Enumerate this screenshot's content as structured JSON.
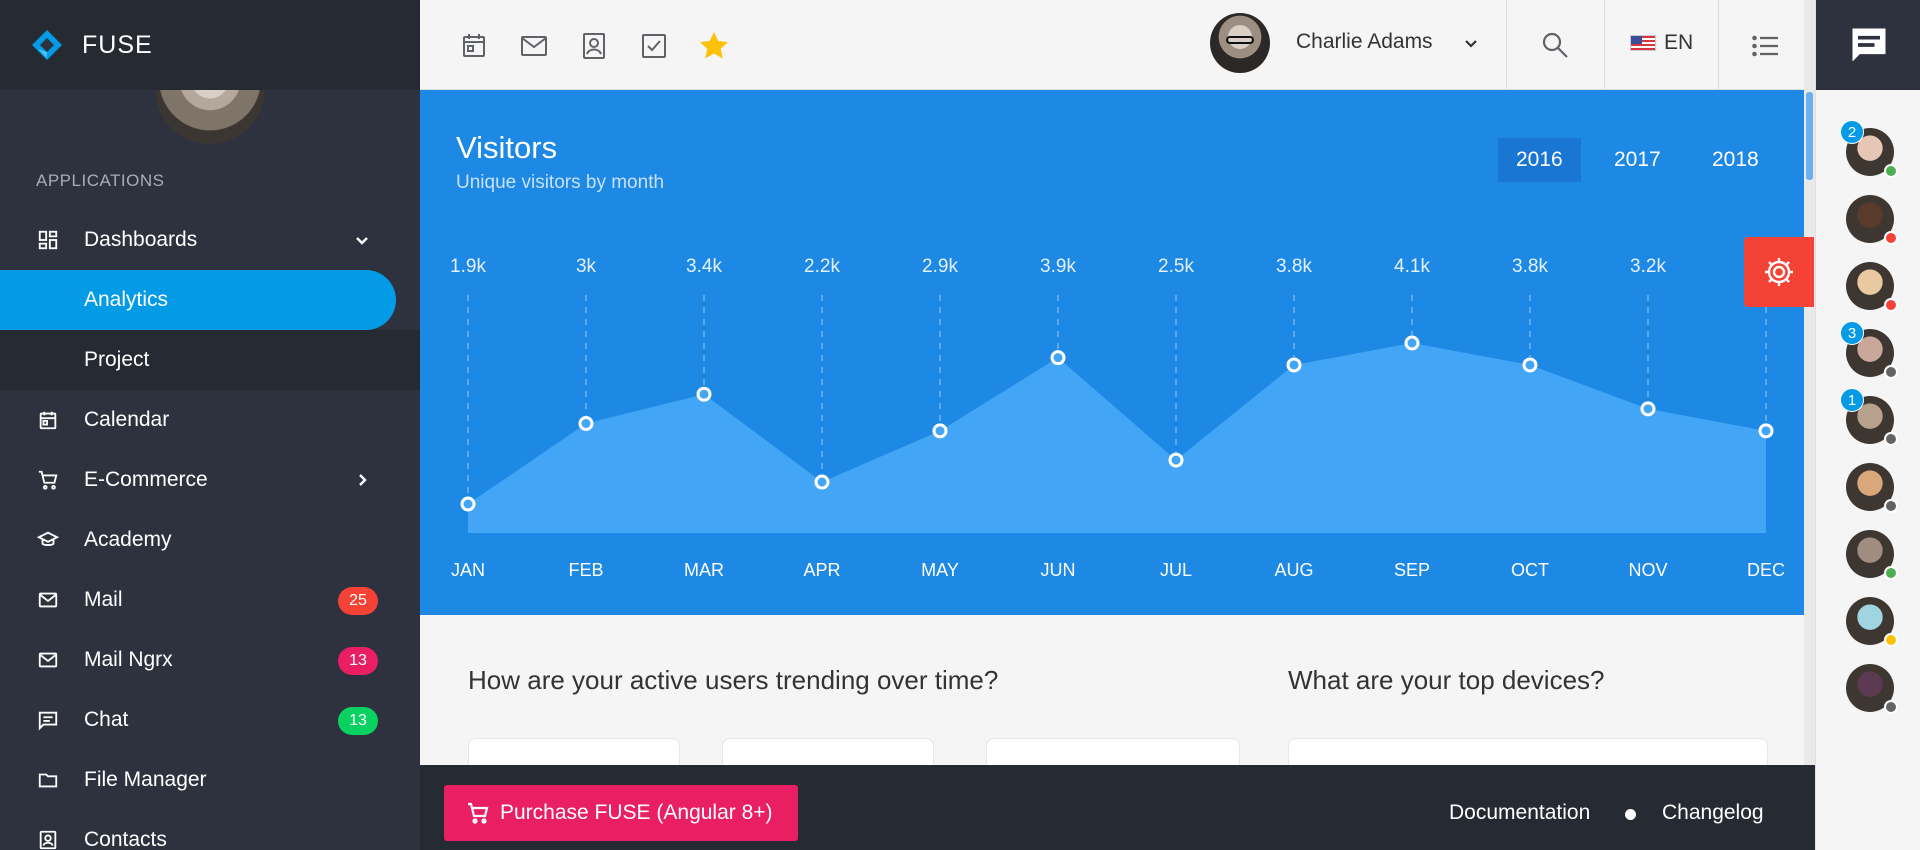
{
  "brand": {
    "name": "FUSE"
  },
  "sidebar": {
    "section_title": "APPLICATIONS",
    "items": [
      {
        "label": "Dashboards",
        "icon": "dashboard-icon",
        "caret": "chevron-down"
      },
      {
        "label": "Analytics",
        "sub": true,
        "active": true
      },
      {
        "label": "Project",
        "sub": true
      },
      {
        "label": "Calendar",
        "icon": "calendar-icon"
      },
      {
        "label": "E-Commerce",
        "icon": "cart-icon",
        "caret": "chevron-right"
      },
      {
        "label": "Academy",
        "icon": "school-icon"
      },
      {
        "label": "Mail",
        "icon": "mail-icon",
        "badge": "25",
        "badge_color": "#f44336"
      },
      {
        "label": "Mail Ngrx",
        "icon": "mail-icon",
        "badge": "13",
        "badge_color": "#e91e63"
      },
      {
        "label": "Chat",
        "icon": "chat-icon",
        "badge": "13",
        "badge_color": "#09d261"
      },
      {
        "label": "File Manager",
        "icon": "folder-icon"
      },
      {
        "label": "Contacts",
        "icon": "contacts-icon"
      }
    ]
  },
  "toolbar": {
    "shortcuts": [
      "calendar-icon",
      "mail-icon",
      "contacts-icon",
      "todo-icon",
      "star-icon"
    ],
    "star_color": "#ffc107",
    "user_name": "Charlie Adams",
    "language": "EN"
  },
  "visitors": {
    "title": "Visitors",
    "subtitle": "Unique visitors by month",
    "years": [
      "2016",
      "2017",
      "2018"
    ],
    "selected_year": "2016"
  },
  "chart_data": {
    "type": "area",
    "title": "Visitors",
    "subtitle": "Unique visitors by month",
    "categories": [
      "JAN",
      "FEB",
      "MAR",
      "APR",
      "MAY",
      "JUN",
      "JUL",
      "AUG",
      "SEP",
      "OCT",
      "NOV",
      "DEC"
    ],
    "values": [
      1.9,
      3.0,
      3.4,
      2.2,
      2.9,
      3.9,
      2.5,
      3.8,
      4.1,
      3.8,
      3.2,
      2.9
    ],
    "value_labels": [
      "1.9k",
      "3k",
      "3.4k",
      "2.2k",
      "2.9k",
      "3.9k",
      "2.5k",
      "3.8k",
      "4.1k",
      "3.8k",
      "3.2k",
      "2.9k"
    ],
    "unit": "thousands",
    "colors": {
      "background": "#1e88e5",
      "fill": "#42a5f5"
    }
  },
  "content": {
    "question_1": "How are your active users trending over time?",
    "question_2": "What are your top devices?"
  },
  "footer": {
    "purchase_label": "Purchase FUSE (Angular 8+)",
    "documentation": "Documentation",
    "changelog": "Changelog"
  },
  "contacts": [
    {
      "unread": "2",
      "status": "online"
    },
    {
      "unread": "",
      "status": "do-not-disturb"
    },
    {
      "unread": "",
      "status": "do-not-disturb"
    },
    {
      "unread": "3",
      "status": "offline"
    },
    {
      "unread": "1",
      "status": "offline"
    },
    {
      "unread": "",
      "status": "offline"
    },
    {
      "unread": "",
      "status": "online"
    },
    {
      "unread": "",
      "status": "away"
    },
    {
      "unread": "",
      "status": "offline"
    }
  ]
}
